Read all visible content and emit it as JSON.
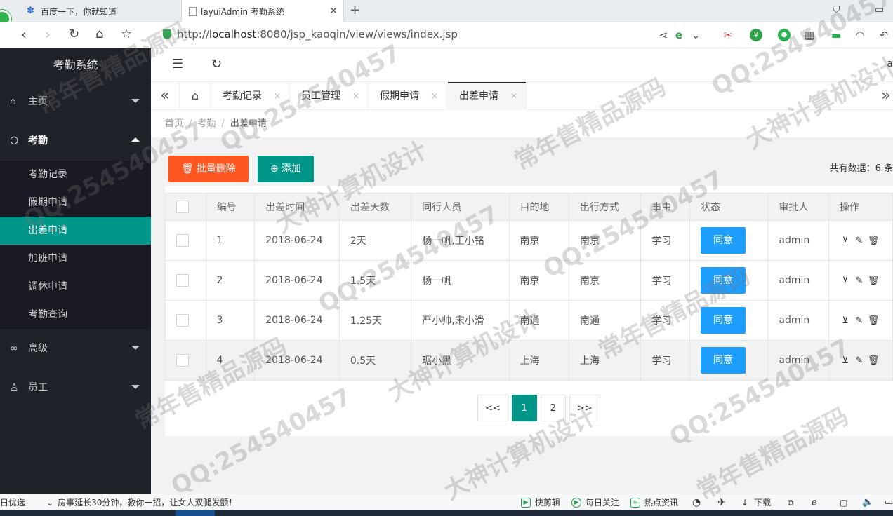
{
  "browser": {
    "tabs": [
      {
        "title": "百度一下，你就知道"
      },
      {
        "title": "layuiAdmin 考勤系统"
      }
    ],
    "url_prefix": "http://",
    "url_host": "localhost",
    "url_rest": ":8080/jsp_kaoqin/view/views/index.jsp"
  },
  "sidebar": {
    "title": "考勤系统",
    "groups": {
      "home": {
        "label": "主页"
      },
      "attendance": {
        "label": "考勤"
      },
      "advanced": {
        "label": "高级"
      },
      "staff": {
        "label": "员工"
      }
    },
    "items": [
      {
        "label": "考勤记录"
      },
      {
        "label": "假期申请"
      },
      {
        "label": "出差申请"
      },
      {
        "label": "加班申请"
      },
      {
        "label": "调休申请"
      },
      {
        "label": "考勤查询"
      }
    ]
  },
  "header": {
    "cut_text": "a"
  },
  "pagetabs": [
    {
      "label": "考勤记录"
    },
    {
      "label": "员工管理"
    },
    {
      "label": "假期申请"
    },
    {
      "label": "出差申请"
    }
  ],
  "breadcrumb": {
    "home": "首页",
    "section": "考勤",
    "current": "出差申请"
  },
  "toolbar": {
    "batch_delete": "批量删除",
    "add": "添加",
    "total": "共有数据：6 条"
  },
  "table": {
    "columns": [
      "编号",
      "出差时间",
      "出差天数",
      "同行人员",
      "目的地",
      "出行方式",
      "事由",
      "状态",
      "审批人",
      "操作"
    ],
    "rows": [
      {
        "id": "1",
        "date": "2018-06-24",
        "days": "2天",
        "companions": "杨一帆,王小铭",
        "destination": "南京",
        "transport": "南京",
        "reason": "学习",
        "status": "同意",
        "approver": "admin"
      },
      {
        "id": "2",
        "date": "2018-06-24",
        "days": "1.5天",
        "companions": "杨一帆",
        "destination": "南京",
        "transport": "南京",
        "reason": "学习",
        "status": "同意",
        "approver": "admin"
      },
      {
        "id": "3",
        "date": "2018-06-24",
        "days": "1.25天",
        "companions": "严小帅,宋小滑",
        "destination": "南通",
        "transport": "南通",
        "reason": "学习",
        "status": "同意",
        "approver": "admin"
      },
      {
        "id": "4",
        "date": "2018-06-24",
        "days": "0.5天",
        "companions": "琚小黑",
        "destination": "上海",
        "transport": "上海",
        "reason": "学习",
        "status": "同意",
        "approver": "admin"
      }
    ]
  },
  "pager": {
    "prev": "<<",
    "pages": [
      "1",
      "2"
    ],
    "current": "1",
    "next": ">>"
  },
  "statusbar": {
    "left1": "日优选",
    "news": "房事延长30分钟，教你一招，让女人双腿发颤！",
    "clip": "快剪辑",
    "follow": "每日关注",
    "hot": "热点资讯",
    "download": "下载"
  },
  "watermarks": [
    "QQ:254540457",
    "大神计算机设计",
    "常年售精品源码"
  ]
}
